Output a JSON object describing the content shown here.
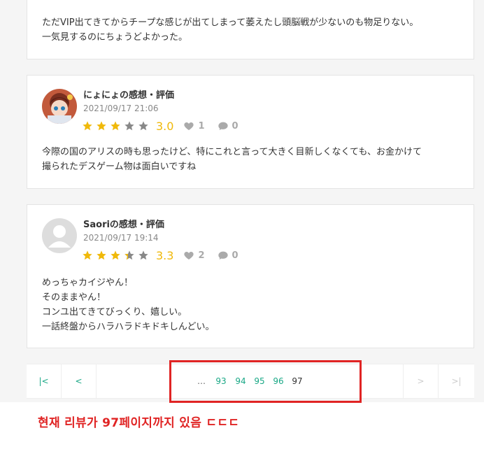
{
  "reviews": [
    {
      "text_lines": [
        "ただVIP出てきてからチープな感じが出てしまって萎えたし頭脳戦が少ないのも物足りない。",
        "一気見するのにちょうどよかった。"
      ]
    },
    {
      "name": "にょにょの感想・評価",
      "date": "2021/09/17 21:06",
      "score": "3.0",
      "rating": 3.0,
      "likes": "1",
      "comments": "0",
      "avatar": "anime-avatar",
      "text_lines": [
        "今際の国のアリスの時も思ったけど、特にこれと言って大きく目新しくなくても、お金かけて",
        "撮られたデスゲーム物は面白いですね"
      ]
    },
    {
      "name": "Saoriの感想・評価",
      "date": "2021/09/17 19:14",
      "score": "3.3",
      "rating": 3.3,
      "likes": "2",
      "comments": "0",
      "avatar": "default-user-avatar",
      "text_lines": [
        "めっちゃカイジやん！",
        "そのままやん！",
        "コンユ出てきてびっくり、嬉しい。",
        "一話終盤からハラハラドキドキしんどい。"
      ]
    }
  ],
  "pagination": {
    "first": "|<",
    "prev": "<",
    "ellipsis": "…",
    "pages": [
      "93",
      "94",
      "95",
      "96"
    ],
    "current": "97",
    "next": ">",
    "last": ">|"
  },
  "annotation": "현재 리뷰가 97페이지까지 있음 ㄷㄷㄷ",
  "colors": {
    "accent": "#1aa886",
    "star": "#f0b90a",
    "star_empty": "#888888",
    "highlight": "#e02424"
  }
}
